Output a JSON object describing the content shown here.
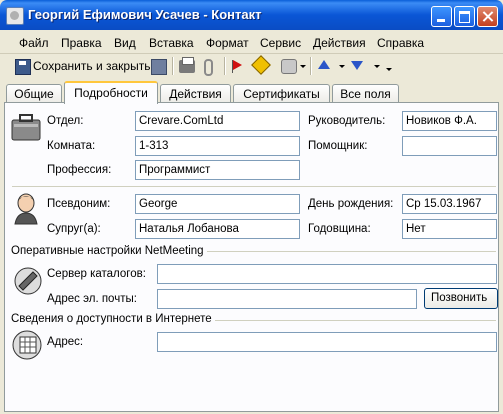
{
  "window": {
    "title": "Георгий Ефимович Усачев - Контакт"
  },
  "menu": [
    "Файл",
    "Правка",
    "Вид",
    "Вставка",
    "Формат",
    "Сервис",
    "Действия",
    "Справка"
  ],
  "toolbar": {
    "save_label": "Сохранить и закрыть"
  },
  "tabs": [
    "Общие",
    "Подробности",
    "Действия",
    "Сертификаты",
    "Все поля"
  ],
  "form": {
    "department": {
      "label": "Отдел:",
      "value": "Crevare.ComLtd"
    },
    "office": {
      "label": "Комната:",
      "value": "1-313"
    },
    "profession": {
      "label": "Профессия:",
      "value": "Программист"
    },
    "manager": {
      "label": "Руководитель:",
      "value": "Новиков Ф.А."
    },
    "assistant": {
      "label": "Помощник:",
      "value": ""
    },
    "nickname": {
      "label": "Псевдоним:",
      "value": "George"
    },
    "spouse": {
      "label": "Супруг(а):",
      "value": "Наталья Лобанова"
    },
    "birthday": {
      "label": "День рождения:",
      "value": "Ср 15.03.1967"
    },
    "anniversary": {
      "label": "Годовщина:",
      "value": "Нет"
    }
  },
  "netmeeting": {
    "title": "Оперативные настройки NetMeeting",
    "directory_server": {
      "label": "Сервер каталогов:",
      "value": ""
    },
    "email": {
      "label": "Адрес эл. почты:",
      "value": ""
    },
    "call_button": "Позвонить"
  },
  "freebusy": {
    "title": "Сведения о доступности в Интернете",
    "address": {
      "label": "Адрес:",
      "value": ""
    }
  }
}
